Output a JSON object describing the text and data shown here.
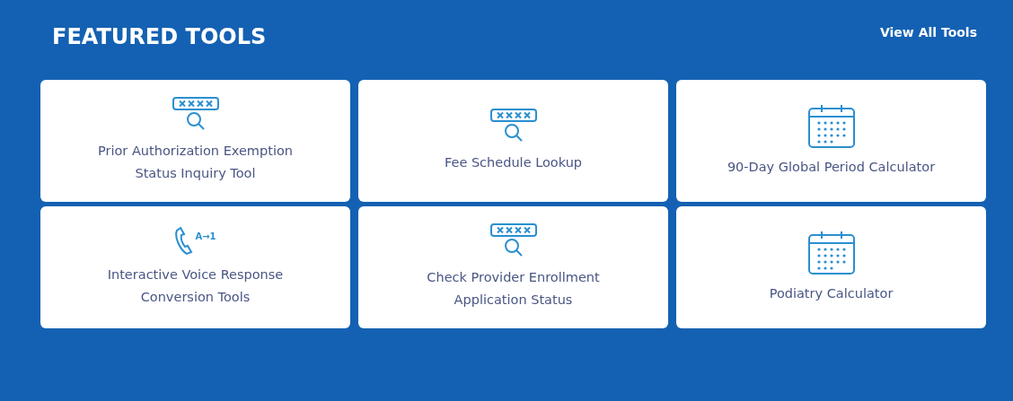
{
  "header": {
    "title": "FEATURED TOOLS",
    "link": "View All Tools"
  },
  "tools": [
    {
      "label": "Prior Authorization Exemption Status Inquiry Tool",
      "kind": "lookup"
    },
    {
      "label": "Fee Schedule Lookup",
      "kind": "lookup"
    },
    {
      "label": "90-Day Global Period Calculator",
      "kind": "calculator"
    },
    {
      "label": "Interactive Voice Response Conversion Tools",
      "kind": "conversion",
      "icon_text": "A→1"
    },
    {
      "label": "Check Provider Enrollment Application Status",
      "kind": "lookup"
    },
    {
      "label": "Podiatry Calculator",
      "kind": "calculator"
    }
  ]
}
